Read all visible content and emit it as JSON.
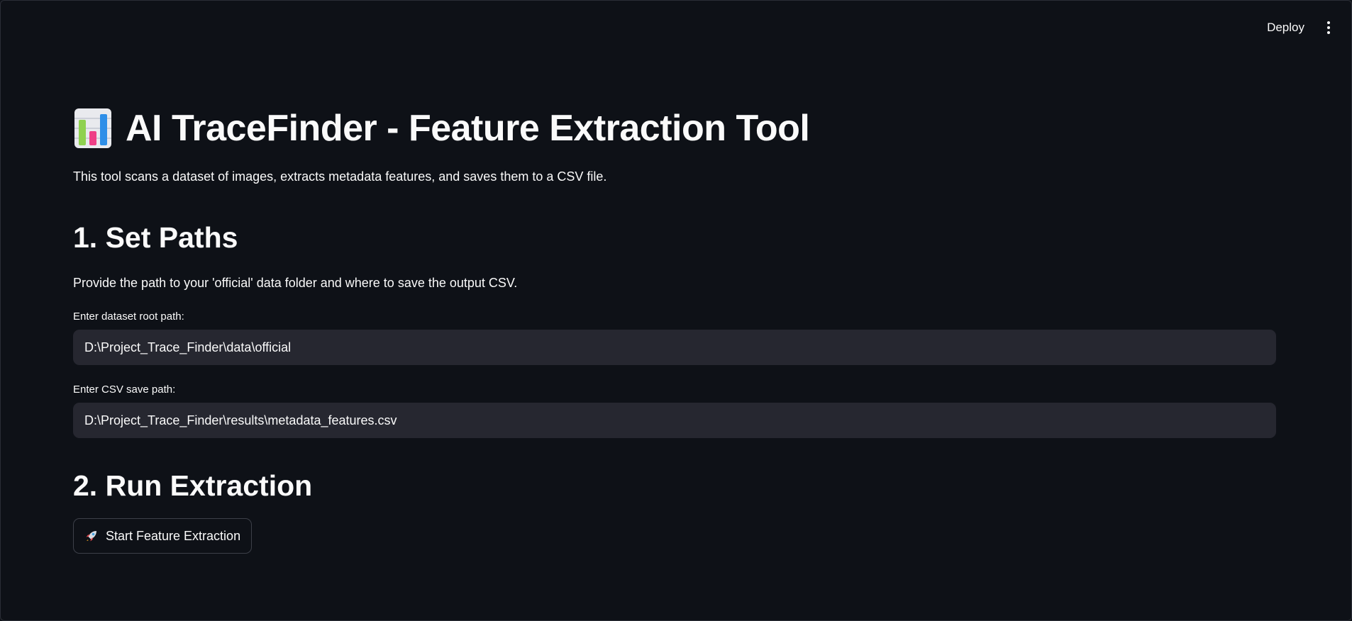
{
  "header": {
    "deploy_label": "Deploy",
    "menu_icon": "kebab-menu-icon"
  },
  "page": {
    "title_icon": "bar-chart-icon",
    "title": "AI TraceFinder - Feature Extraction Tool",
    "intro": "This tool scans a dataset of images, extracts metadata features, and saves them to a CSV file."
  },
  "section_paths": {
    "heading": "1. Set Paths",
    "description": "Provide the path to your 'official' data folder and where to save the output CSV.",
    "dataset_label": "Enter dataset root path:",
    "dataset_value": "D:\\Project_Trace_Finder\\data\\official",
    "csv_label": "Enter CSV save path:",
    "csv_value": "D:\\Project_Trace_Finder\\results\\metadata_features.csv"
  },
  "section_run": {
    "heading": "2. Run Extraction",
    "button_icon": "rocket-icon",
    "button_label": "Start Feature Extraction"
  },
  "colors": {
    "background": "#0e1117",
    "input_background": "#262730",
    "text": "#fafafa",
    "button_border": "#3d4049"
  }
}
